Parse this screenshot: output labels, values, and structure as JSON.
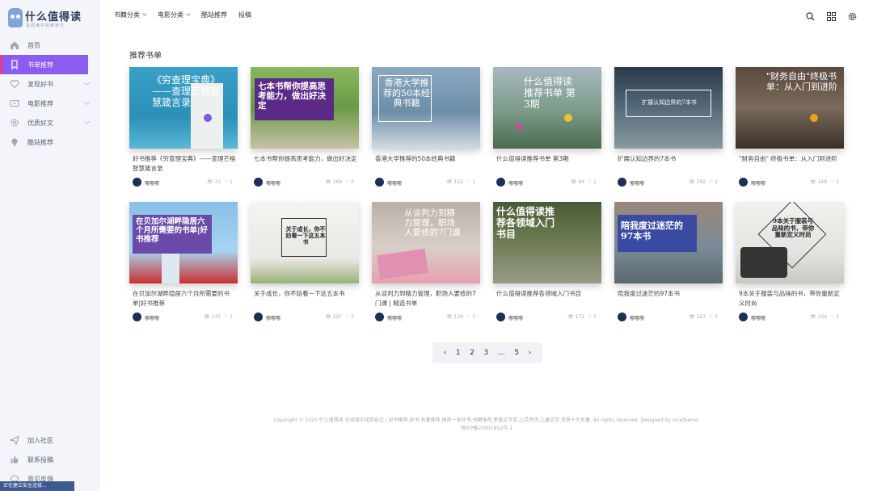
{
  "app": {
    "title": "什么值得读",
    "subtitle": "在阅读中找到自己"
  },
  "sidebar": {
    "items": [
      {
        "label": "首页",
        "icon": "home-icon",
        "active": false
      },
      {
        "label": "书单推荐",
        "icon": "bookmark-icon",
        "active": true
      },
      {
        "label": "发现好书",
        "icon": "heart-icon",
        "active": false
      },
      {
        "label": "电影推荐",
        "icon": "video-icon",
        "active": false
      },
      {
        "label": "优质好文",
        "icon": "gear-icon",
        "active": false
      },
      {
        "label": "酷站推荐",
        "icon": "bulb-icon",
        "active": false
      }
    ],
    "bottom": [
      {
        "label": "加入社区",
        "icon": "send-icon"
      },
      {
        "label": "联系投稿",
        "icon": "thumbs-up-icon"
      },
      {
        "label": "意见反馈",
        "icon": "chat-icon"
      }
    ]
  },
  "status_text": "正在建立安全连接...",
  "topnav": [
    "书籍分类",
    "电影分类",
    "酷站推荐",
    "投稿"
  ],
  "topicons": [
    "search-icon",
    "grid-icon",
    "settings-icon"
  ],
  "section_title": "推荐书单",
  "cards": [
    {
      "title": "好书推荐《穷查理宝典》——查理芒格智慧箴言录",
      "author": "嘟嘟嘟",
      "views": "72",
      "likes": "1",
      "cover": "《穷查理宝典》——查理芒格智慧箴言录"
    },
    {
      "title": "七本书帮你提高思考能力，做出好决定",
      "author": "嘟嘟嘟",
      "views": "169",
      "likes": "0",
      "cover": "七本书帮你提高思考能力，做出好决定"
    },
    {
      "title": "香港大学推荐的50本经典书籍",
      "author": "嘟嘟嘟",
      "views": "152",
      "likes": "1",
      "cover": "香港大学推荐的50本经典书籍"
    },
    {
      "title": "什么值得读推荐书单 第3期",
      "author": "嘟嘟嘟",
      "views": "84",
      "likes": "1",
      "cover": "什么值得读推荐书单 第3期"
    },
    {
      "title": "扩展认知边界的7本书",
      "author": "嘟嘟嘟",
      "views": "192",
      "likes": "2",
      "cover": "扩展认知边界的7本书"
    },
    {
      "title": "\"财务自由\" 终极书单：从入门到进阶",
      "author": "嘟嘟嘟",
      "views": "168",
      "likes": "1",
      "cover": "\"财务自由\"终极书单：从入门到进阶"
    },
    {
      "title": "在贝加尔湖畔隐居六个月所需要的书单|好书推荐",
      "author": "嘟嘟嘟",
      "views": "145",
      "likes": "1",
      "cover": "在贝加尔湖畔隐居六个月所需要的书单|好书推荐"
    },
    {
      "title": "关于成长，你不妨看一下这五本书",
      "author": "嘟嘟嘟",
      "views": "197",
      "likes": "2",
      "cover": "关于成长，你不妨看一下这五本书"
    },
    {
      "title": "从谈判力到精力管理，职场人要修的7门课 | 精选书单",
      "author": "嘟嘟嘟",
      "views": "139",
      "likes": "1",
      "cover": "从谈判力到精力管理，职场人要修的7门课"
    },
    {
      "title": "什么值得读推荐各领域入门书目",
      "author": "嘟嘟嘟",
      "views": "172",
      "likes": "1",
      "cover": "什么值得读推荐各领域入门书目"
    },
    {
      "title": "陪我度过迷茫的97本书",
      "author": "嘟嘟嘟",
      "views": "167",
      "likes": "0",
      "cover": "陪我度过迷茫的97本书"
    },
    {
      "title": "9本关于服装与品味的书，带你重新定义时尚",
      "author": "嘟嘟嘟",
      "views": "104",
      "likes": "2",
      "cover": "9本关于服装与品味的书，带你重新定义时尚"
    }
  ],
  "pagination": {
    "prev": "‹",
    "pages": [
      "1",
      "2",
      "3",
      "…",
      "5"
    ],
    "next": "›"
  },
  "footer": {
    "line1": "Copyright © 2020 什么值得读-在阅读中找到自己 | 好书推荐,好书,名著推荐,推荐一本好书,书籍推荐,茅盾文学奖,心灵鸡汤,儿童文学,世界十大名著. All rights reserved. Designed by nicetheme.",
    "line2": "陕ICP备20001852号-1"
  },
  "colors": {
    "accent": "#8a5cf0",
    "sidebar_bg": "#f4f5fa"
  }
}
